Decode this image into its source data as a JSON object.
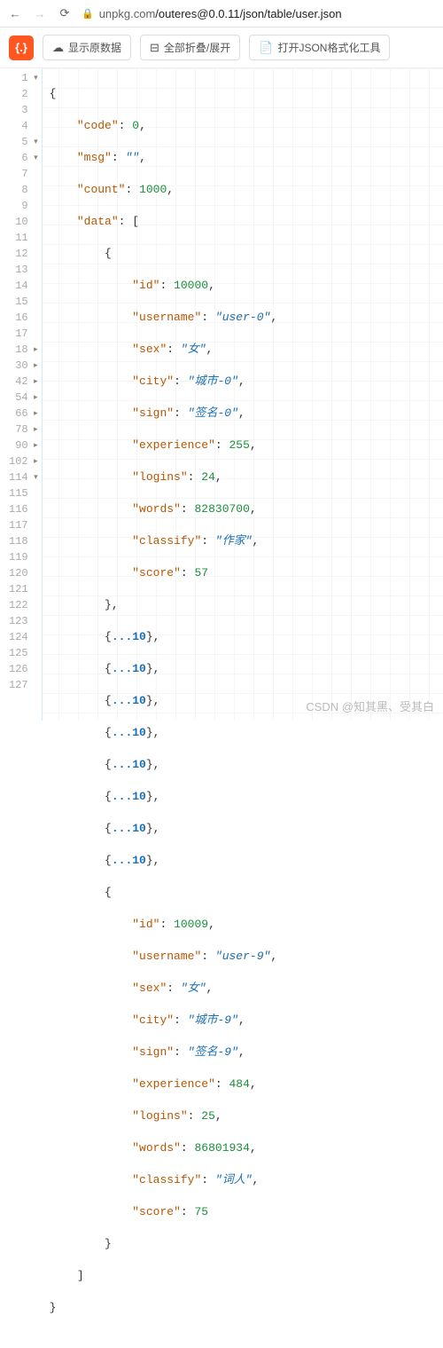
{
  "browser": {
    "url_host": "unpkg.com",
    "url_path": "/outeres@0.0.11/json/table/user.json"
  },
  "toolbar": {
    "logo": "{.}",
    "show_raw": "显示原数据",
    "fold_all": "全部折叠/展开",
    "open_tool": "打开JSON格式化工具"
  },
  "watermark": "CSDN @知其黑、受其白",
  "json_keys": {
    "code": "code",
    "msg": "msg",
    "count": "count",
    "data": "data",
    "id": "id",
    "username": "username",
    "sex": "sex",
    "city": "city",
    "sign": "sign",
    "experience": "experience",
    "logins": "logins",
    "words": "words",
    "classify": "classify",
    "score": "score"
  },
  "json": {
    "code": 0,
    "msg": "",
    "count": 1000,
    "data_open_0": {
      "id": 10000,
      "username": "user-0",
      "sex": "女",
      "city": "城市-0",
      "sign": "签名-0",
      "experience": 255,
      "logins": 24,
      "words": 82830700,
      "classify": "作家",
      "score": 57
    },
    "data_open_9": {
      "id": 10009,
      "username": "user-9",
      "sex": "女",
      "city": "城市-9",
      "sign": "签名-9",
      "experience": 484,
      "logins": 25,
      "words": 86801934,
      "classify": "词人",
      "score": 75
    }
  },
  "fold": {
    "count": "10"
  },
  "lines": {
    "expanded1": [
      "1",
      "2",
      "3",
      "4",
      "5",
      "6",
      "7",
      "8",
      "9",
      "10",
      "11",
      "12",
      "13",
      "14",
      "15",
      "16",
      "17"
    ],
    "folded": [
      "18",
      "30",
      "42",
      "54",
      "66",
      "78",
      "90",
      "102"
    ],
    "expanded2": [
      "114",
      "115",
      "116",
      "117",
      "118",
      "119",
      "120",
      "121",
      "122",
      "123",
      "124",
      "125",
      "126",
      "127"
    ]
  }
}
